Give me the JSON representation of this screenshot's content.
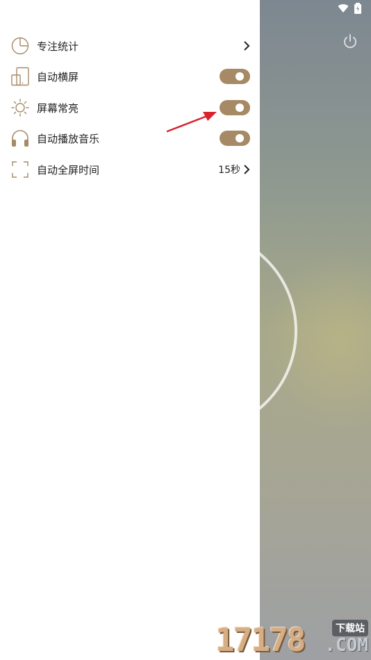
{
  "menu": {
    "items": [
      {
        "label": "专注统计",
        "icon": "pie-chart-icon",
        "trail": "chevron"
      },
      {
        "label": "自动横屏",
        "icon": "rotate-screen-icon",
        "trail": "toggle",
        "on": true
      },
      {
        "label": "屏幕常亮",
        "icon": "brightness-icon",
        "trail": "toggle",
        "on": true
      },
      {
        "label": "自动播放音乐",
        "icon": "headphones-icon",
        "trail": "toggle",
        "on": true
      },
      {
        "label": "自动全屏时间",
        "icon": "fullscreen-icon",
        "trail": "value",
        "value": "15秒"
      }
    ]
  },
  "watermark": {
    "number": "17178",
    "badge": "下载站",
    "domain": ".COM"
  },
  "colors": {
    "accent": "#a58a65",
    "annotation_arrow": "#d9232d"
  }
}
